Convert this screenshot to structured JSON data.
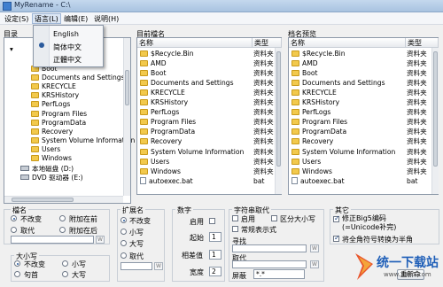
{
  "window": {
    "title": "MyRename - C:\\"
  },
  "menu": [
    "设定(S)",
    "语言(L)",
    "编辑(E)",
    "说明(H)"
  ],
  "language_menu": [
    "English",
    "简体中文",
    "正體中文"
  ],
  "panels": {
    "directory_title": "目录",
    "source_title": "目前檔名",
    "preview_title": "档名预览",
    "col_name": "名称",
    "col_type": "类型"
  },
  "tree": {
    "items": [
      "Boot",
      "Documents and Settings",
      "KRECYCLE",
      "KRSHistory",
      "PerfLogs",
      "Program Files",
      "ProgramData",
      "Recovery",
      "System Volume Information",
      "Users",
      "Windows"
    ],
    "drives": [
      "本地磁盘 (D:)",
      "DVD 驱动器 (E:)"
    ]
  },
  "files": [
    {
      "name": "$Recycle.Bin",
      "type": "资料夹"
    },
    {
      "name": "AMD",
      "type": "资料夹"
    },
    {
      "name": "Boot",
      "type": "资料夹"
    },
    {
      "name": "Documents and Settings",
      "type": "资料夹"
    },
    {
      "name": "KRECYCLE",
      "type": "资料夹"
    },
    {
      "name": "KRSHistory",
      "type": "资料夹"
    },
    {
      "name": "PerfLogs",
      "type": "资料夹"
    },
    {
      "name": "Program Files",
      "type": "资料夹"
    },
    {
      "name": "ProgramData",
      "type": "资料夹"
    },
    {
      "name": "Recovery",
      "type": "资料夹"
    },
    {
      "name": "System Volume Information",
      "type": "资料夹"
    },
    {
      "name": "Users",
      "type": "资料夹"
    },
    {
      "name": "Windows",
      "type": "资料夹"
    },
    {
      "name": "autoexec.bat",
      "type": "bat"
    }
  ],
  "options": {
    "filename_group": "檔名",
    "fn_keep": "不改变",
    "fn_prefix": "附加在前",
    "fn_replace": "取代",
    "fn_suffix": "附加在后",
    "case_group": "大小写",
    "case_keep": "不改变",
    "case_lower": "小写",
    "case_first": "句首",
    "case_upper": "大写",
    "ext_group": "扩展名",
    "ext_keep": "不改变",
    "ext_lower": "小写",
    "ext_upper": "大写",
    "ext_replace": "取代",
    "number_group": "数字",
    "num_enable": "启用",
    "num_start_label": "起始",
    "num_start": "1",
    "num_step_label": "相差值",
    "num_step": "1",
    "num_width_label": "宽度",
    "num_width": "2",
    "string_group": "字符串取代",
    "str_enable": "启用",
    "str_case": "区分大小写",
    "str_regex": "常规表示式",
    "str_find": "寻找",
    "str_replace": "取代",
    "mask_label": "屏蔽",
    "mask_value": "*.*",
    "other_group": "其它",
    "other_big5": "修正Big5编码(=Unicode补完)",
    "other_fullwidth": "将全角符号转换为半角",
    "rename_button": "重新命",
    "w_mark": "W"
  },
  "watermark": {
    "brand": "统一下载站",
    "url": "www.3987.com"
  }
}
